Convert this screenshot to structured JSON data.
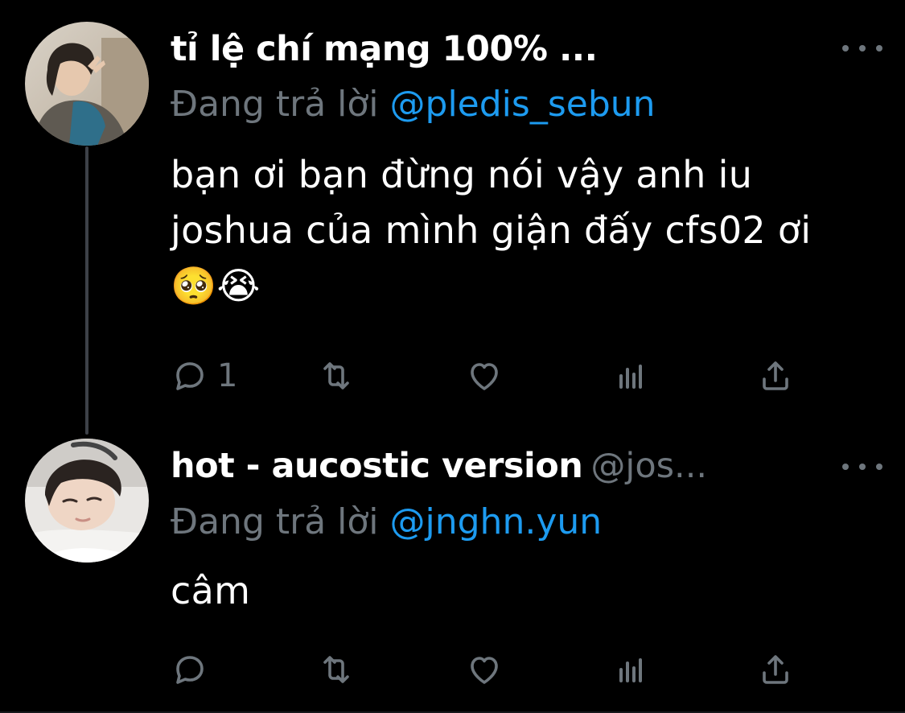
{
  "theme": {
    "background": "#000000",
    "text_primary": "#ffffff",
    "text_secondary": "#6e767d",
    "accent": "#1d9bf0",
    "thread_line": "#3d4148"
  },
  "tweets": [
    {
      "display_name": "tỉ lệ chí mạng 100% ...",
      "handle": "",
      "reply_prefix": "Đang trả lời ",
      "reply_to": "@pledis_sebun",
      "text": "bạn ơi bạn đừng nói vậy anh iu joshua của mình giận đấy cfs02 ơi 🥺😭",
      "reply_count": "1",
      "icons": [
        "reply-icon",
        "retweet-icon",
        "like-icon",
        "stats-icon",
        "share-icon"
      ]
    },
    {
      "display_name": "hot - aucostic version",
      "handle": "@jos...",
      "reply_prefix": "Đang trả lời ",
      "reply_to": "@jnghn.yun",
      "text": "câm",
      "reply_count": "",
      "icons": [
        "reply-icon",
        "retweet-icon",
        "like-icon",
        "stats-icon",
        "share-icon"
      ]
    }
  ]
}
